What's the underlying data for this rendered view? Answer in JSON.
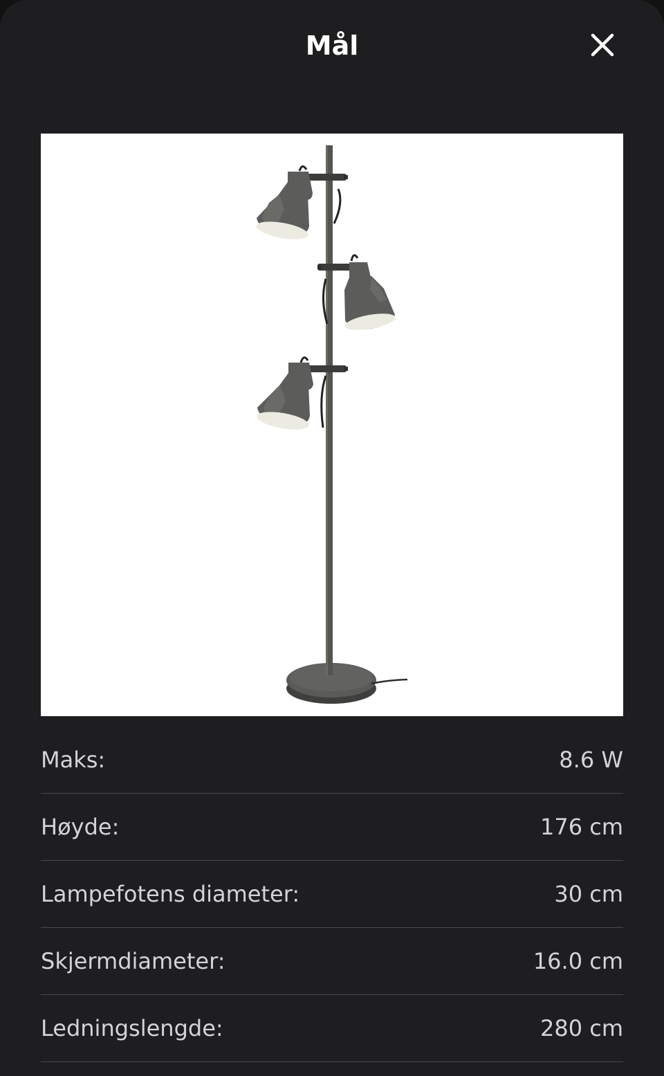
{
  "header": {
    "title": "Mål",
    "close_icon": "close-icon"
  },
  "product_image": {
    "subject": "floor-lamp-three-spotlights"
  },
  "specs": [
    {
      "label": "Maks:",
      "value": "8.6 W"
    },
    {
      "label": "Høyde:",
      "value": "176 cm"
    },
    {
      "label": "Lampefotens diameter:",
      "value": "30 cm"
    },
    {
      "label": "Skjermdiameter:",
      "value": "16.0 cm"
    },
    {
      "label": "Ledningslengde:",
      "value": "280 cm"
    }
  ],
  "colors": {
    "background": "#1e1e20",
    "text": "#d4d4d6",
    "divider": "#4a4a4e",
    "lamp": "#5c5c5a"
  }
}
